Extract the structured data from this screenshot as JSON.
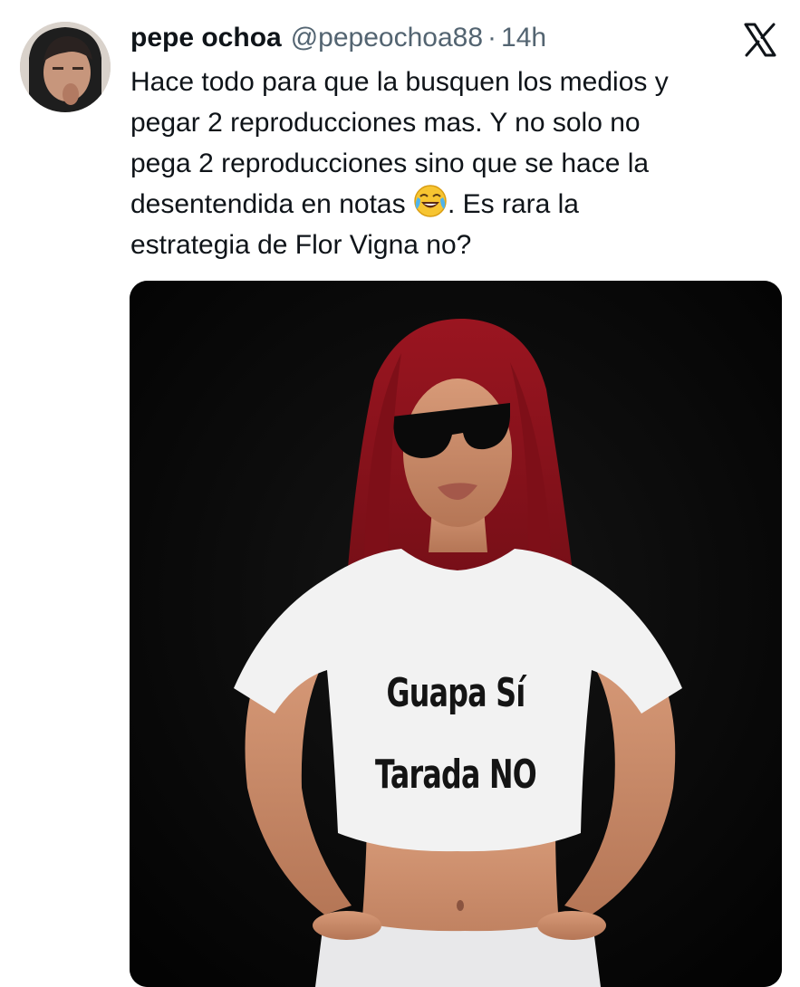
{
  "tweet": {
    "display_name": "pepe ochoa",
    "handle": "@pepeochoa88",
    "separator": "·",
    "time": "14h",
    "text_before_emoji": "Hace todo para que la busquen los medios y\npegar 2 reproducciones mas. Y no solo no\npega 2 reproducciones sino que se hace la\ndesentendida en notas ",
    "emoji": "face-with-tears-of-joy",
    "text_after_emoji": ". Es rara la\nestrategia de Flor Vigna no?"
  },
  "platform": {
    "logo": "x-logo-icon"
  },
  "media": {
    "shirt_text_line1": "Guapa Sí",
    "shirt_text_line2": "Tarada NO"
  },
  "colors": {
    "text_primary": "#0f1419",
    "text_secondary": "#536471",
    "media_background": "#050505",
    "hair": "#7a0f16",
    "shirt": "#f2f2f2",
    "skin": "#c98a6a"
  }
}
